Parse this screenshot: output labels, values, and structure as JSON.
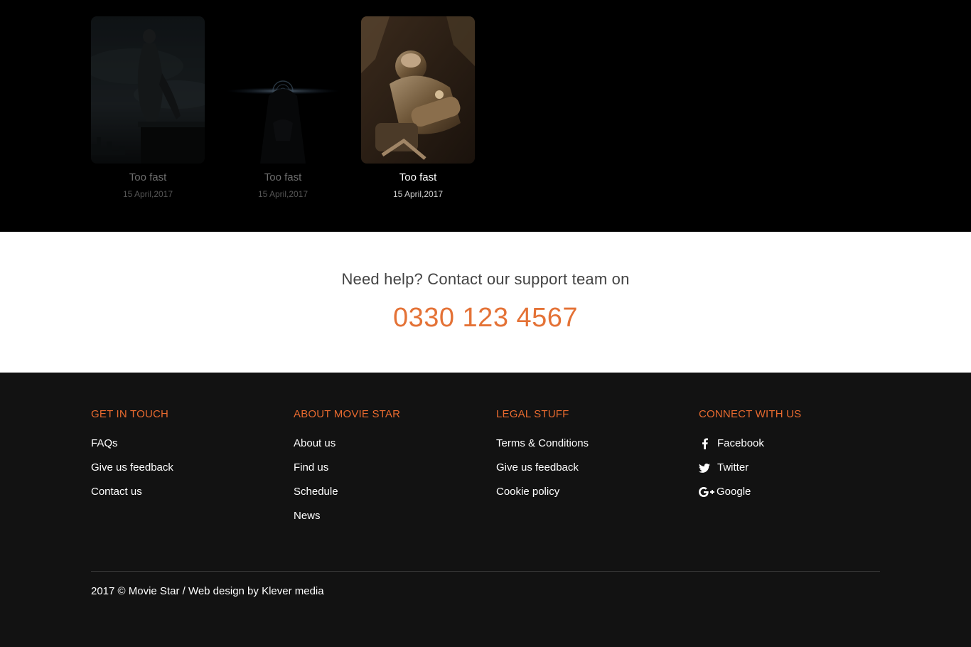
{
  "movies": [
    {
      "title": "Too fast",
      "date": "15 April,2017",
      "state": "dim"
    },
    {
      "title": "Too fast",
      "date": "15 April,2017",
      "state": "dim"
    },
    {
      "title": "Too fast",
      "date": "15 April,2017",
      "state": "active"
    }
  ],
  "support": {
    "text": "Need help? Contact our support team on",
    "phone": "0330 123 4567",
    "accent_color": "#e47236"
  },
  "footer": {
    "accent_color": "#e86a2f",
    "columns": [
      {
        "heading": "GET IN TOUCH",
        "links": [
          "FAQs",
          "Give us feedback",
          "Contact us"
        ]
      },
      {
        "heading": "ABOUT MOVIE STAR",
        "links": [
          "About us",
          "Find us",
          "Schedule",
          "News"
        ]
      },
      {
        "heading": "LEGAL STUFF",
        "links": [
          "Terms & Conditions",
          "Give us feedback",
          "Cookie policy"
        ]
      },
      {
        "heading": "CONNECT WITH US",
        "links": [
          {
            "icon": "facebook-icon",
            "label": "Facebook"
          },
          {
            "icon": "twitter-icon",
            "label": "Twitter"
          },
          {
            "icon": "google-plus-icon",
            "label": "Google"
          }
        ]
      }
    ],
    "copyright": "2017 © Movie Star / Web design by Klever media"
  }
}
